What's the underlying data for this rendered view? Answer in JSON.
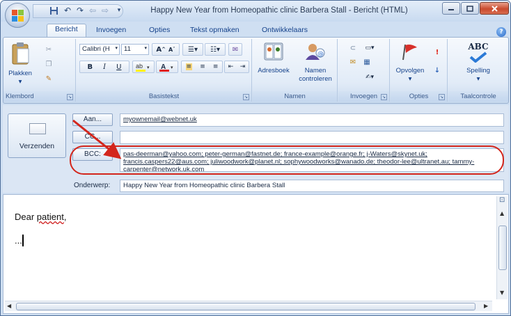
{
  "window": {
    "title": "Happy New Year from Homeopathic clinic Barbera Stall - Bericht (HTML)"
  },
  "tabs": [
    "Bericht",
    "Invoegen",
    "Opties",
    "Tekst opmaken",
    "Ontwikkelaars"
  ],
  "ribbon": {
    "clipboard": {
      "paste_label": "Plakken",
      "group_label": "Klembord"
    },
    "basic_text": {
      "font_name": "Calibri (H",
      "font_size": "11",
      "group_label": "Basistekst",
      "bold": "B",
      "italic": "I",
      "underline": "U",
      "grow": "A",
      "shrink": "A"
    },
    "names": {
      "address_book": "Adresboek",
      "check_names_1": "Namen",
      "check_names_2": "controleren",
      "group_label": "Namen"
    },
    "insert": {
      "group_label": "Invoegen"
    },
    "options": {
      "follow_up": "Opvolgen",
      "group_label": "Opties"
    },
    "proofing": {
      "spelling": "Spelling",
      "abc": "ABC",
      "group_label": "Taalcontrole"
    }
  },
  "header": {
    "send_label": "Verzenden",
    "to_label": "Aan...",
    "cc_label": "CC...",
    "bcc_label": "BCC:",
    "subject_label": "Onderwerp:",
    "to_value": "myownemail@webnet.uk",
    "cc_value": "",
    "bcc_value": "pas-deerman@yahoo.com; peter-german@fastnet.de; france-example@orange.fr; j-Waters@skynet.uk; francis.caspers22@aus.com; juliwoodwork@planet.nl; sophywoodworks@wanado.de; theodor-lee@ultranet.au; tammy-carpenter@network.uk.com",
    "subject_value": "Happy New Year from Homeopathic clinic Barbera Stall"
  },
  "message": {
    "greeting_1": "Dear ",
    "greeting_2": "patient",
    "greeting_3": ",",
    "body": "..."
  },
  "colors": {
    "accent": "#15428b",
    "highlight": "#d3261c"
  }
}
